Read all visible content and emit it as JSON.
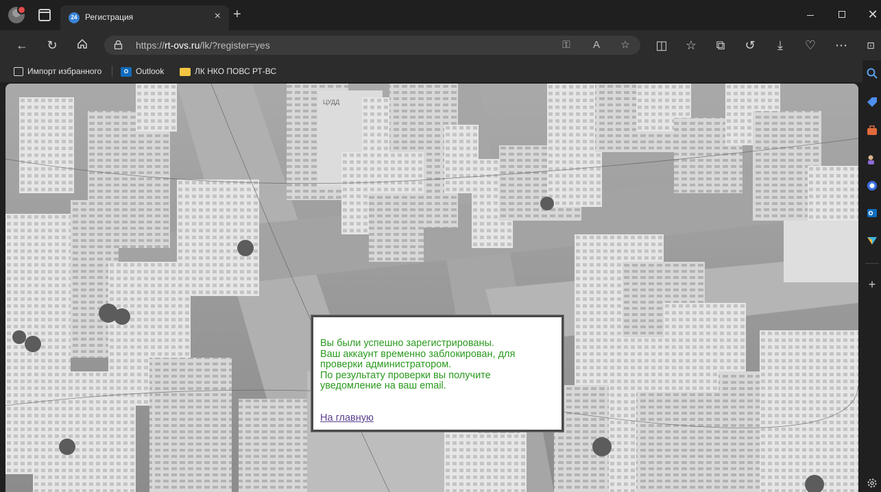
{
  "browser": {
    "tab": {
      "title": "Регистрация",
      "favicon_text": "24",
      "close_glyph": "×"
    },
    "new_tab_glyph": "+",
    "address_bar": {
      "scheme": "https://",
      "host": "rt-ovs.ru",
      "path": "/lk/?register=yes"
    },
    "bookmarks": [
      {
        "label": "Импорт избранного",
        "icon": "import-icon"
      },
      {
        "label": "Outlook",
        "icon": "outlook-icon",
        "icon_text": "O"
      },
      {
        "label": "ЛК НКО ПОВС РТ-ВС",
        "icon": "folder-icon"
      }
    ],
    "sidebar_icons": [
      "search-icon",
      "tag-icon",
      "briefcase-icon",
      "games-icon",
      "copilot-icon",
      "outlook-icon",
      "send-icon",
      "add-icon",
      "settings-icon"
    ]
  },
  "page": {
    "message_lines": [
      "Вы были успешно зарегистрированы.",
      "Ваш аккаунт временно заблокирован, для",
      "проверки администратором.",
      "По результату проверки вы получите",
      "уведомление на ваш email."
    ],
    "home_link": "На главную",
    "message_color": "#2a9a1e",
    "link_color": "#5a3f8f",
    "building_sign": "ЦУДД"
  }
}
